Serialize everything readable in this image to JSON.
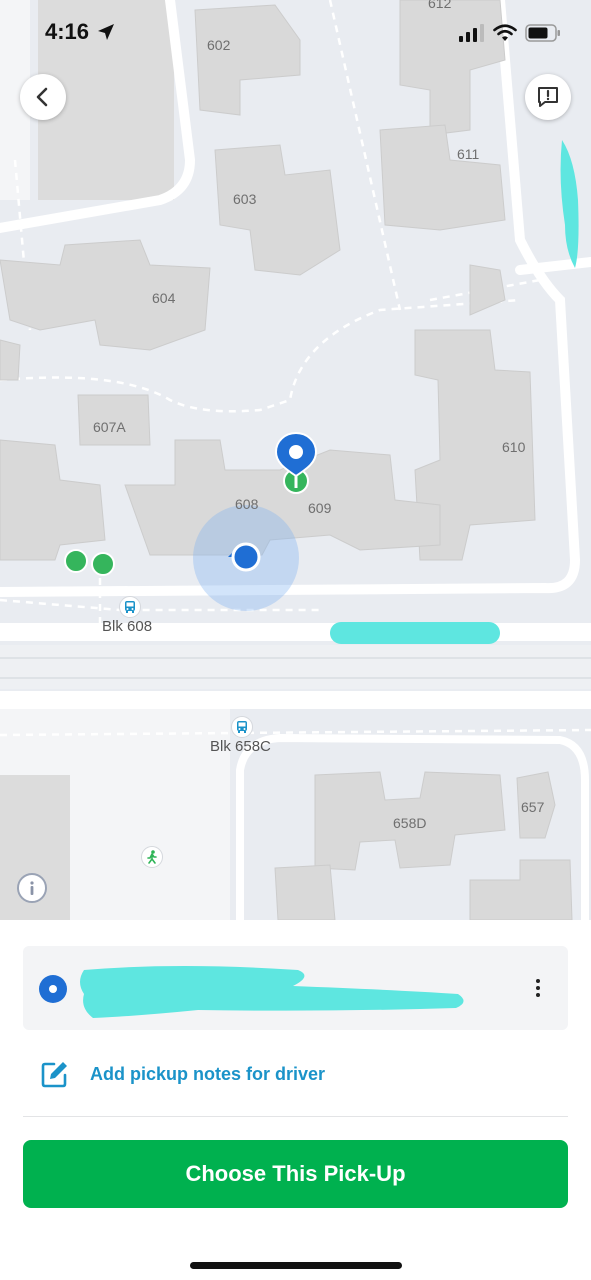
{
  "status_bar": {
    "time": "4:16"
  },
  "map": {
    "block_labels": [
      "612",
      "602",
      "611",
      "603",
      "604",
      "607A",
      "610",
      "608",
      "609",
      "658D",
      "657"
    ],
    "bus_stops": [
      "Blk 608",
      "Blk 658C"
    ]
  },
  "sheet": {
    "notes_label": "Add pickup notes for driver",
    "cta_label": "Choose This Pick-Up"
  },
  "colors": {
    "accent_green": "#00b14f",
    "link_blue": "#1b93c9",
    "pin_blue": "#1f6ed4",
    "redaction": "#5ee6e0"
  },
  "icons": {
    "back": "chevron-left-icon",
    "report": "report-icon",
    "location": "location-pin-icon",
    "edit": "edit-note-icon",
    "more": "more-vertical-icon",
    "bus": "bus-icon",
    "walk": "pedestrian-icon",
    "info": "info-icon"
  }
}
